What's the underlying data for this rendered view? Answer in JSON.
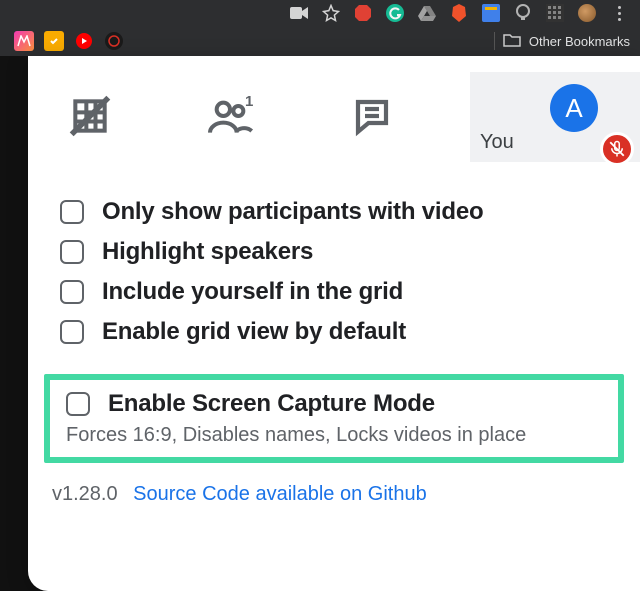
{
  "bookmarkbar": {
    "other": "Other Bookmarks"
  },
  "self_tile": {
    "label": "You",
    "avatar_letter": "A"
  },
  "options": [
    {
      "label": "Only show participants with video"
    },
    {
      "label": "Highlight speakers"
    },
    {
      "label": "Include yourself in the grid"
    },
    {
      "label": "Enable grid view by default"
    }
  ],
  "highlight": {
    "label": "Enable Screen Capture Mode",
    "sub": "Forces 16:9, Disables names, Locks videos in place"
  },
  "footer": {
    "version": "v1.28.0",
    "link": "Source Code available on Github"
  }
}
